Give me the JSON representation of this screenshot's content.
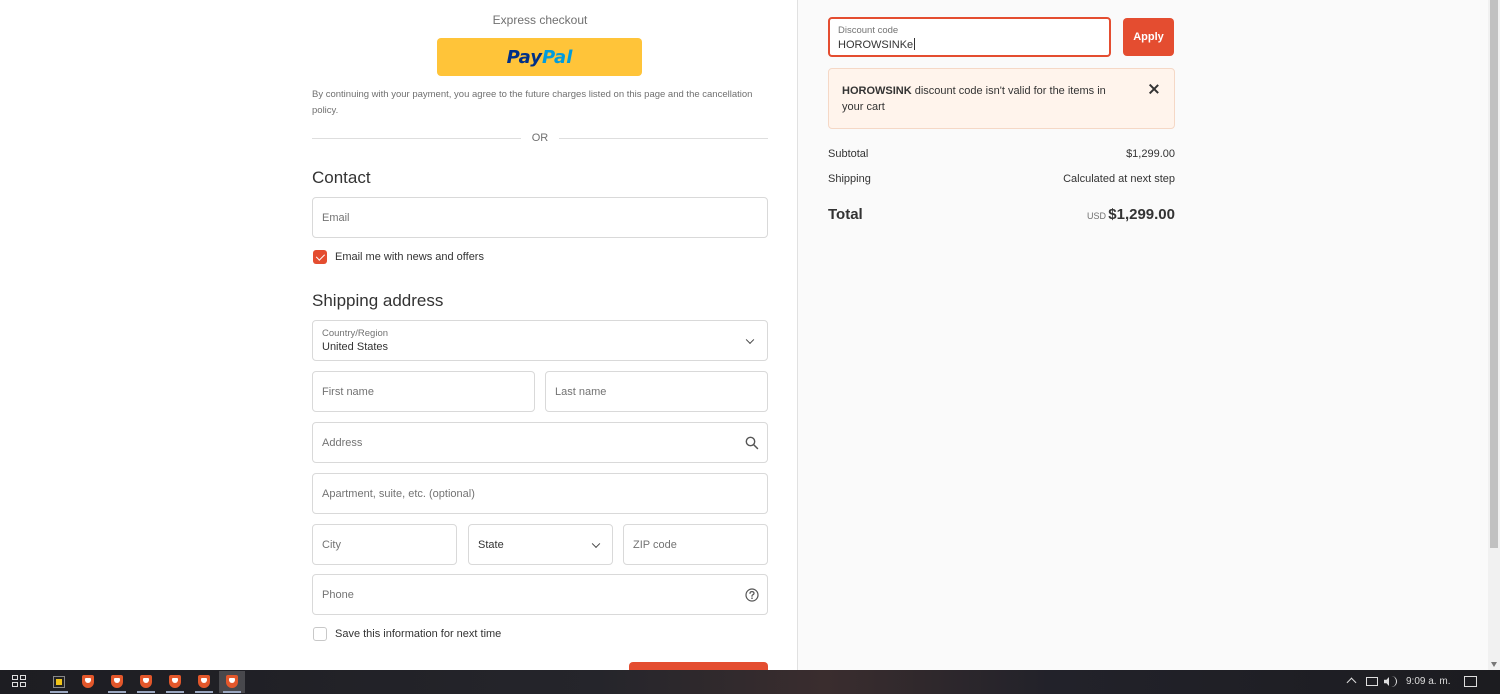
{
  "express": {
    "title": "Express checkout",
    "paypal_part1": "Pay",
    "paypal_part2": "Pal",
    "policy": "By continuing with your payment, you agree to the future charges listed on this page and the cancellation policy.",
    "or": "OR"
  },
  "contact": {
    "title": "Contact",
    "email_placeholder": "Email",
    "news_label": "Email me with news and offers",
    "news_checked": true
  },
  "shipping": {
    "title": "Shipping address",
    "country_label": "Country/Region",
    "country_value": "United States",
    "first_name": "First name",
    "last_name": "Last name",
    "address": "Address",
    "apartment": "Apartment, suite, etc. (optional)",
    "city": "City",
    "state": "State",
    "zip": "ZIP code",
    "phone": "Phone",
    "save_label": "Save this information for next time"
  },
  "summary": {
    "discount_label": "Discount code",
    "discount_value": "HOROWSINKe",
    "apply": "Apply",
    "error_code": "HOROWSINK",
    "error_message": " discount code isn't valid for the items in your cart",
    "subtotal_label": "Subtotal",
    "subtotal_value": "$1,299.00",
    "shipping_label": "Shipping",
    "shipping_value": "Calculated at next step",
    "total_label": "Total",
    "total_currency": "USD",
    "total_value": "$1,299.00"
  },
  "taskbar": {
    "clock": "9:09 a. m."
  },
  "colors": {
    "accent": "#e44d30",
    "paypal_yellow": "#ffc439",
    "error_bg": "#fff4ec"
  }
}
